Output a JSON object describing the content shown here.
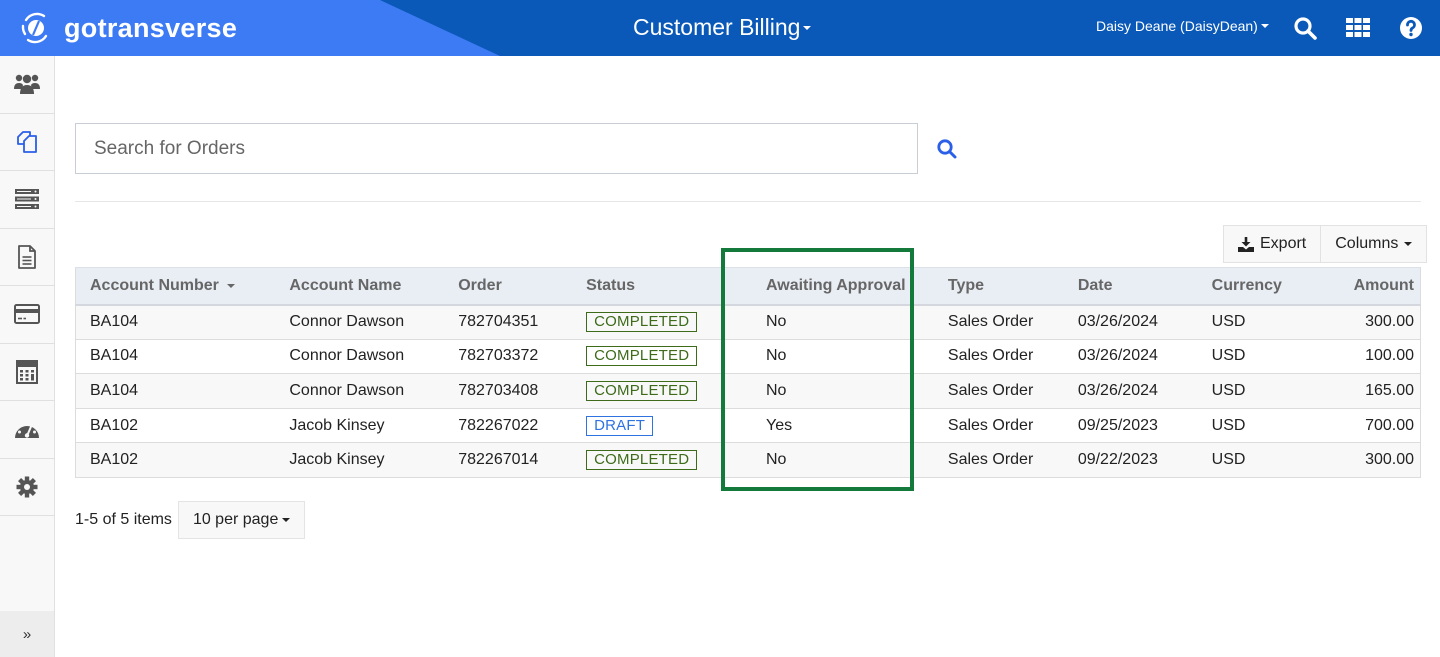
{
  "header": {
    "brand": "gotransverse",
    "app_title": "Customer Billing",
    "user": "Daisy Deane (DaisyDean)",
    "icons": [
      "search-icon",
      "apps-grid-icon",
      "help-icon"
    ],
    "colors": {
      "bar": "#0a59b8",
      "brand_bg": "#3d7bf5"
    }
  },
  "sidebar": {
    "items": [
      {
        "icon": "users-icon",
        "active": false
      },
      {
        "icon": "orders-icon",
        "active": true
      },
      {
        "icon": "server-list-icon",
        "active": false
      },
      {
        "icon": "document-icon",
        "active": false
      },
      {
        "icon": "credit-card-icon",
        "active": false
      },
      {
        "icon": "calculator-icon",
        "active": false
      },
      {
        "icon": "dashboard-gauge-icon",
        "active": false
      },
      {
        "icon": "gear-icon",
        "active": false
      }
    ],
    "expand_label": "»"
  },
  "search": {
    "placeholder": "Search for Orders",
    "value": ""
  },
  "toolbar": {
    "export_label": "Export",
    "columns_label": "Columns"
  },
  "table": {
    "columns": [
      "Account Number",
      "Account Name",
      "Order",
      "Status",
      "Awaiting Approval",
      "Type",
      "Date",
      "Currency",
      "Amount"
    ],
    "sorted_column": "Account Number",
    "rows": [
      {
        "account_number": "BA104",
        "account_name": "Connor Dawson",
        "order": "782704351",
        "status": "COMPLETED",
        "awaiting_approval": "No",
        "type": "Sales Order",
        "date": "03/26/2024",
        "currency": "USD",
        "amount": "300.00"
      },
      {
        "account_number": "BA104",
        "account_name": "Connor Dawson",
        "order": "782703372",
        "status": "COMPLETED",
        "awaiting_approval": "No",
        "type": "Sales Order",
        "date": "03/26/2024",
        "currency": "USD",
        "amount": "100.00"
      },
      {
        "account_number": "BA104",
        "account_name": "Connor Dawson",
        "order": "782703408",
        "status": "COMPLETED",
        "awaiting_approval": "No",
        "type": "Sales Order",
        "date": "03/26/2024",
        "currency": "USD",
        "amount": "165.00"
      },
      {
        "account_number": "BA102",
        "account_name": "Jacob Kinsey",
        "order": "782267022",
        "status": "DRAFT",
        "awaiting_approval": "Yes",
        "type": "Sales Order",
        "date": "09/25/2023",
        "currency": "USD",
        "amount": "700.00"
      },
      {
        "account_number": "BA102",
        "account_name": "Jacob Kinsey",
        "order": "782267014",
        "status": "COMPLETED",
        "awaiting_approval": "No",
        "type": "Sales Order",
        "date": "09/22/2023",
        "currency": "USD",
        "amount": "300.00"
      }
    ],
    "status_colors": {
      "COMPLETED": "#3d6b1a",
      "DRAFT": "#2e73e0"
    },
    "highlight_color": "#147a3c"
  },
  "pager": {
    "summary": "1-5 of 5 items",
    "per_page": "10 per page"
  }
}
